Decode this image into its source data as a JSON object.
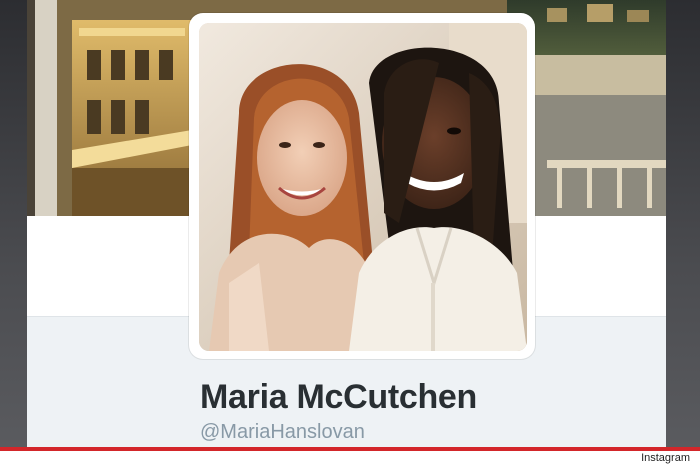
{
  "profile": {
    "name": "Maria McCutchen",
    "handle": "@MariaHanslovan"
  },
  "cover_photo": {
    "description_icon": "header-photo"
  },
  "avatar": {
    "icon": "profile-photo"
  },
  "credit": {
    "source": "Instagram"
  },
  "colors": {
    "accent_bar": "#d3262a",
    "name_text": "#292f33",
    "handle_text": "#8899a6",
    "card_bg": "#ffffff",
    "strip_bg": "#eef2f5"
  }
}
